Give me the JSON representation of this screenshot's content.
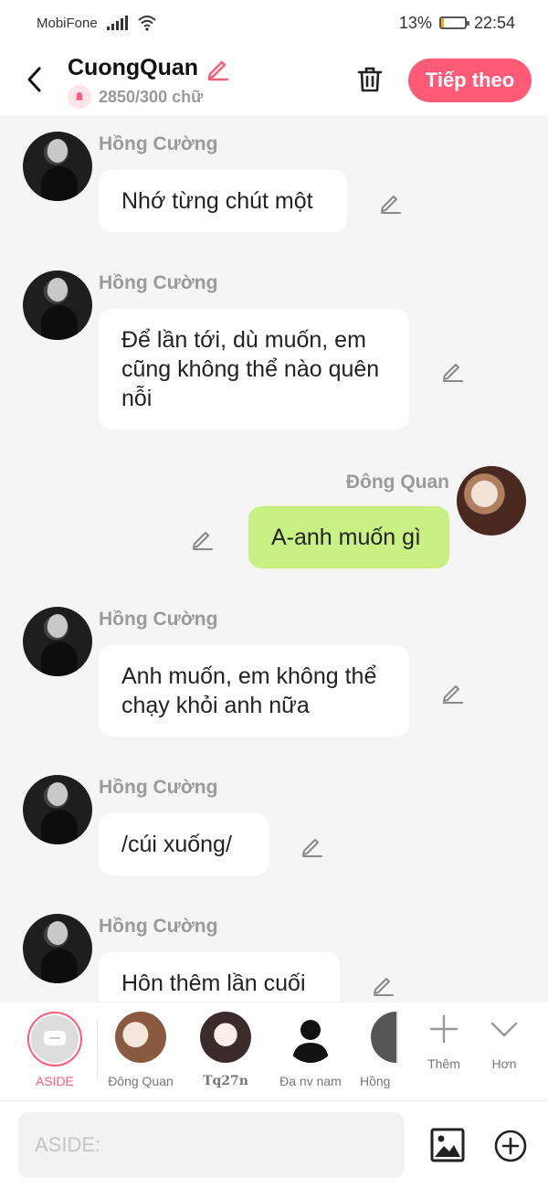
{
  "status_bar": {
    "carrier": "MobiFone",
    "battery": "13%",
    "battery_level": 0.13,
    "time": "22:54"
  },
  "header": {
    "title": "CuongQuan",
    "subtitle": "2850/300 chữ",
    "next_label": "Tiếp theo"
  },
  "messages": [
    {
      "sender": "Hồng Cường",
      "text": "Nhớ từng chút một",
      "side": "left"
    },
    {
      "sender": "Hồng Cường",
      "text": "Để lần tới, dù muốn, em cũng không thể nào quên nỗi",
      "side": "left"
    },
    {
      "sender": "Đông Quan",
      "text": "A-anh muốn gì",
      "side": "right"
    },
    {
      "sender": "Hồng Cường",
      "text": "Anh muốn, em không thể chạy khỏi anh nữa",
      "side": "left"
    },
    {
      "sender": "Hồng Cường",
      "text": "/cúi xuống/",
      "side": "left"
    },
    {
      "sender": "Hồng Cường",
      "text": "Hôn thêm lần cuối",
      "side": "left"
    }
  ],
  "characters": [
    {
      "name": "ASIDE",
      "active": true
    },
    {
      "name": "Đông Quan"
    },
    {
      "name": "Tq27n"
    },
    {
      "name": "Đa nv nam"
    },
    {
      "name": "Hồng"
    }
  ],
  "tools": {
    "add_label": "Thêm",
    "more_label": "Hơn"
  },
  "input": {
    "placeholder": "ASIDE:"
  },
  "colors": {
    "accent": "#ff5a76",
    "my_bubble": "#c9f083",
    "background": "#f5f5f5"
  }
}
